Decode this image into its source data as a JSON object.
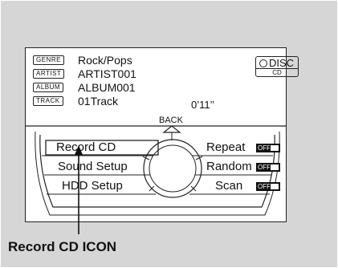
{
  "display": {
    "rows": [
      {
        "tag": "GENRE",
        "value": "Rock/Pops"
      },
      {
        "tag": "ARTIST",
        "value": "ARTIST001"
      },
      {
        "tag": "ALBUM",
        "value": "ALBUM001"
      },
      {
        "tag": "TRACK",
        "value": "01Track"
      }
    ],
    "disc_label": "DISC",
    "source_label": "CD",
    "elapsed_time": "0’11’’"
  },
  "back_label": "BACK",
  "menu": {
    "left": [
      {
        "label": "Record CD"
      },
      {
        "label": "Sound Setup"
      },
      {
        "label": "HDD Setup"
      }
    ],
    "right": [
      {
        "label": "Repeat",
        "state": "OFF",
        "icon": "repeat-icon"
      },
      {
        "label": "Random",
        "state": "OFF",
        "icon": "random-icon"
      },
      {
        "label": "Scan",
        "state": "OFF",
        "icon": "scan-icon"
      }
    ]
  },
  "callout": "Record CD ICON"
}
